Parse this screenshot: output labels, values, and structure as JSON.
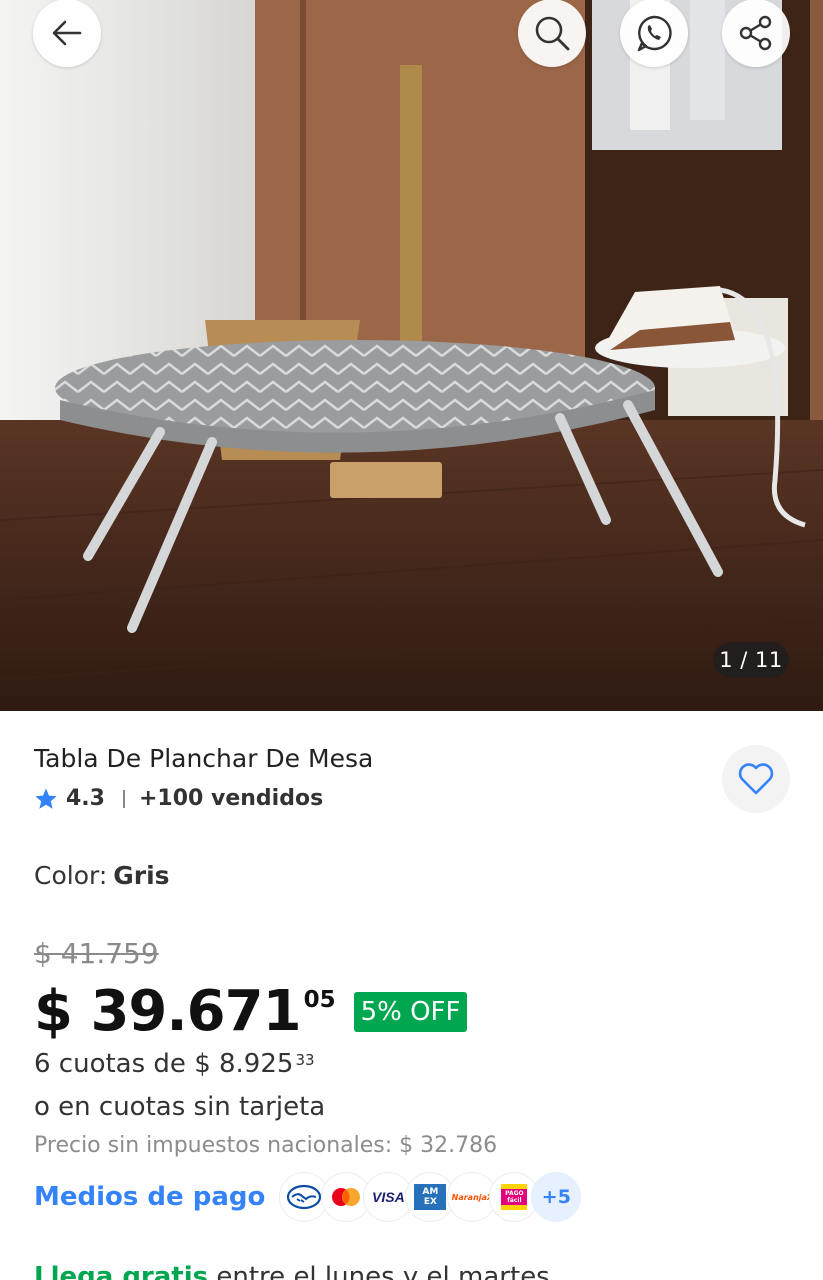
{
  "gallery": {
    "counter": "1 / 11",
    "buttons": {
      "back": "back-arrow-icon",
      "search": "search-icon",
      "whatsapp": "whatsapp-icon",
      "share": "share-icon"
    }
  },
  "product": {
    "title": "Tabla De Planchar De Mesa",
    "rating": "4.3",
    "sold": "+100 vendidos",
    "color_label": "Color:",
    "color_value": "Gris"
  },
  "price": {
    "original": "$ 41.759",
    "current": "$ 39.671",
    "current_cents": "05",
    "discount": "5% OFF",
    "installments_text": "6 cuotas de $ 8.925",
    "installments_cents": "33",
    "no_card_text": "o en cuotas sin tarjeta",
    "tax_text": "Precio sin impuestos nacionales: $ 32.786"
  },
  "payment": {
    "link": "Medios de pago",
    "methods": [
      "mercado-pago-icon",
      "mastercard-icon",
      "visa-icon",
      "amex-icon",
      "naranja-x-icon",
      "pago-facil-icon"
    ],
    "visa_text": "VISA",
    "amex_text": "AM EX",
    "naranja_text": "NaranjaX",
    "pagofacil_text": "PAGO fácil",
    "more": "+5"
  },
  "shipping": {
    "free_label": "Llega gratis",
    "rest": " entre el lunes y el martes"
  },
  "colors": {
    "accent": "#3483fa",
    "green": "#00a650"
  }
}
